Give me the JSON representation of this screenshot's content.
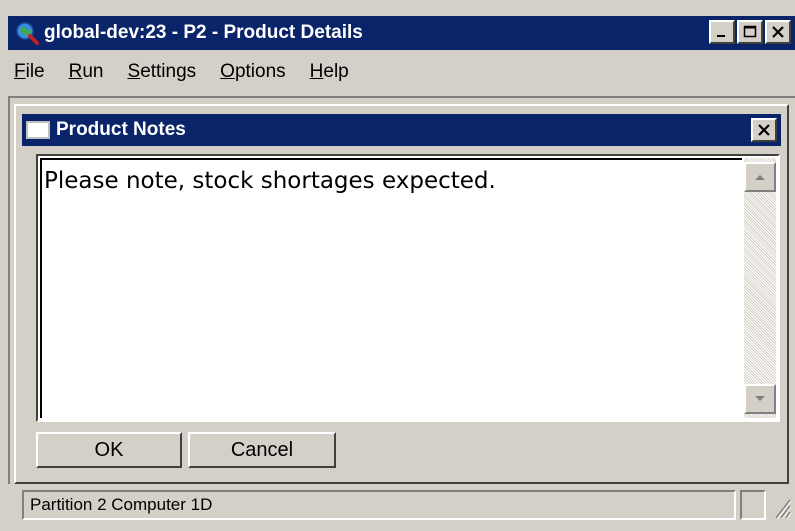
{
  "window": {
    "title": "global-dev:23 - P2 - Product Details",
    "controls": {
      "minimize": "_",
      "maximize": "□",
      "close": "×"
    }
  },
  "menu": {
    "items": [
      {
        "label": "File",
        "mnemonic": "F"
      },
      {
        "label": "Run",
        "mnemonic": "R"
      },
      {
        "label": "Settings",
        "mnemonic": "S"
      },
      {
        "label": "Options",
        "mnemonic": "O"
      },
      {
        "label": "Help",
        "mnemonic": "H"
      }
    ]
  },
  "dialog": {
    "title": "Product Notes",
    "close": "×",
    "notes_text": "Please note, stock shortages expected.",
    "buttons": {
      "ok": "OK",
      "cancel": "Cancel"
    }
  },
  "status": {
    "text": "Partition 2 Computer 1D"
  },
  "colors": {
    "titlebar": "#0a246a",
    "face": "#d4d0c8"
  },
  "icons": {
    "app": "globe-magnifier-icon",
    "dialog": "window-icon"
  }
}
